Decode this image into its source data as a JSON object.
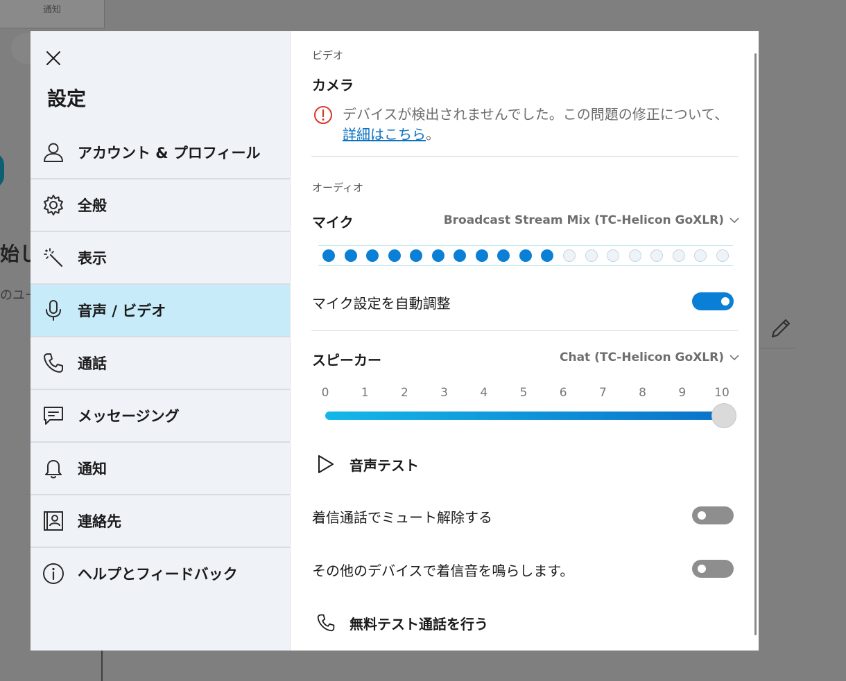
{
  "background": {
    "tab_label": "通知",
    "partial_heading": "始し",
    "partial_text": "のユー"
  },
  "sidebar": {
    "title": "設定",
    "items": [
      {
        "label": "アカウント & プロフィール",
        "icon": "person-icon"
      },
      {
        "label": "全般",
        "icon": "gear-icon"
      },
      {
        "label": "表示",
        "icon": "magic-wand-icon"
      },
      {
        "label": "音声 / ビデオ",
        "icon": "microphone-icon",
        "active": true
      },
      {
        "label": "通話",
        "icon": "phone-icon"
      },
      {
        "label": "メッセージング",
        "icon": "message-icon"
      },
      {
        "label": "通知",
        "icon": "bell-icon"
      },
      {
        "label": "連絡先",
        "icon": "contact-card-icon"
      },
      {
        "label": "ヘルプとフィードバック",
        "icon": "info-icon"
      }
    ]
  },
  "video": {
    "section_label": "ビデオ",
    "camera_heading": "カメラ",
    "warning_text": "デバイスが検出されませんでした。この問題の修正について、",
    "warning_link": "詳細はこちら",
    "warning_end": "。"
  },
  "audio": {
    "section_label": "オーディオ",
    "mic_heading": "マイク",
    "mic_device": "Broadcast Stream Mix (TC-Helicon GoXLR)",
    "mic_level_active": 11,
    "mic_level_total": 19,
    "auto_adjust_label": "マイク設定を自動調整",
    "auto_adjust_on": true,
    "speaker_heading": "スピーカー",
    "speaker_device": "Chat (TC-Helicon GoXLR)",
    "volume_ticks": [
      "0",
      "1",
      "2",
      "3",
      "4",
      "5",
      "6",
      "7",
      "8",
      "9",
      "10"
    ],
    "volume_value": 10,
    "sound_test_label": "音声テスト",
    "unmute_incoming_label": "着信通話でミュート解除する",
    "unmute_incoming_on": false,
    "ring_other_devices_label": "その他のデバイスで着信音を鳴らします。",
    "ring_other_devices_on": false,
    "free_test_call_label": "無料テスト通話を行う"
  },
  "colors": {
    "accent": "#0a7fd6",
    "active_nav": "#c8ebf9",
    "warning": "#d9352b",
    "link": "#0a72c2"
  }
}
